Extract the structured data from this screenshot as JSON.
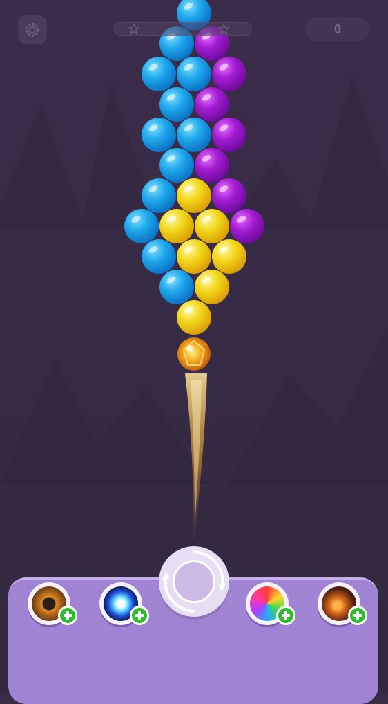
{
  "score": {
    "value": "0"
  },
  "colors": {
    "background": "#3a2b47",
    "blue": "#1fa8ec",
    "purple": "#a21cd1",
    "yellow": "#f3d71a",
    "fireball": "#f0a11a",
    "panel": "#a083d3"
  },
  "icons": {
    "settings": "gear-icon",
    "progress_star": "star-icon",
    "swap": "swap-arrows-icon",
    "boosters": [
      "bomb-icon",
      "lightning-ball-icon",
      "rainbow-ball-icon",
      "fireball-icon",
      "plus-icon"
    ]
  },
  "bubbles": [
    {
      "color": "blue"
    },
    {
      "color": "blue"
    },
    {
      "color": "purple"
    },
    {
      "color": "blue"
    },
    {
      "color": "blue"
    },
    {
      "color": "purple"
    },
    {
      "color": "blue"
    },
    {
      "color": "purple"
    },
    {
      "color": "blue"
    },
    {
      "color": "blue"
    },
    {
      "color": "purple"
    },
    {
      "color": "blue"
    },
    {
      "color": "purple"
    },
    {
      "color": "blue"
    },
    {
      "color": "yellow"
    },
    {
      "color": "purple"
    },
    {
      "color": "blue"
    },
    {
      "color": "yellow"
    },
    {
      "color": "yellow"
    },
    {
      "color": "purple"
    },
    {
      "color": "blue"
    },
    {
      "color": "yellow"
    },
    {
      "color": "yellow"
    },
    {
      "color": "blue"
    },
    {
      "color": "yellow"
    },
    {
      "color": "yellow"
    }
  ],
  "projectile": {
    "type": "fireball"
  }
}
